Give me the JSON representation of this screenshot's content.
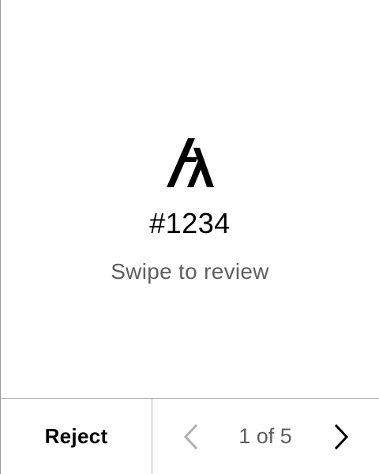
{
  "review": {
    "logo_icon": "algorand-logo-icon",
    "transaction_id": "#1234",
    "hint": "Swipe to review"
  },
  "footer": {
    "reject_label": "Reject",
    "pager": {
      "current": 1,
      "total": 5,
      "label": "1 of 5",
      "prev_icon": "chevron-left-icon",
      "next_icon": "chevron-right-icon",
      "prev_enabled": false,
      "next_enabled": true
    }
  },
  "colors": {
    "background": "#ffffff",
    "text_primary": "#000000",
    "text_secondary": "#5f5f5f",
    "disabled": "#b0b0b0",
    "divider": "#b5b5b5"
  }
}
